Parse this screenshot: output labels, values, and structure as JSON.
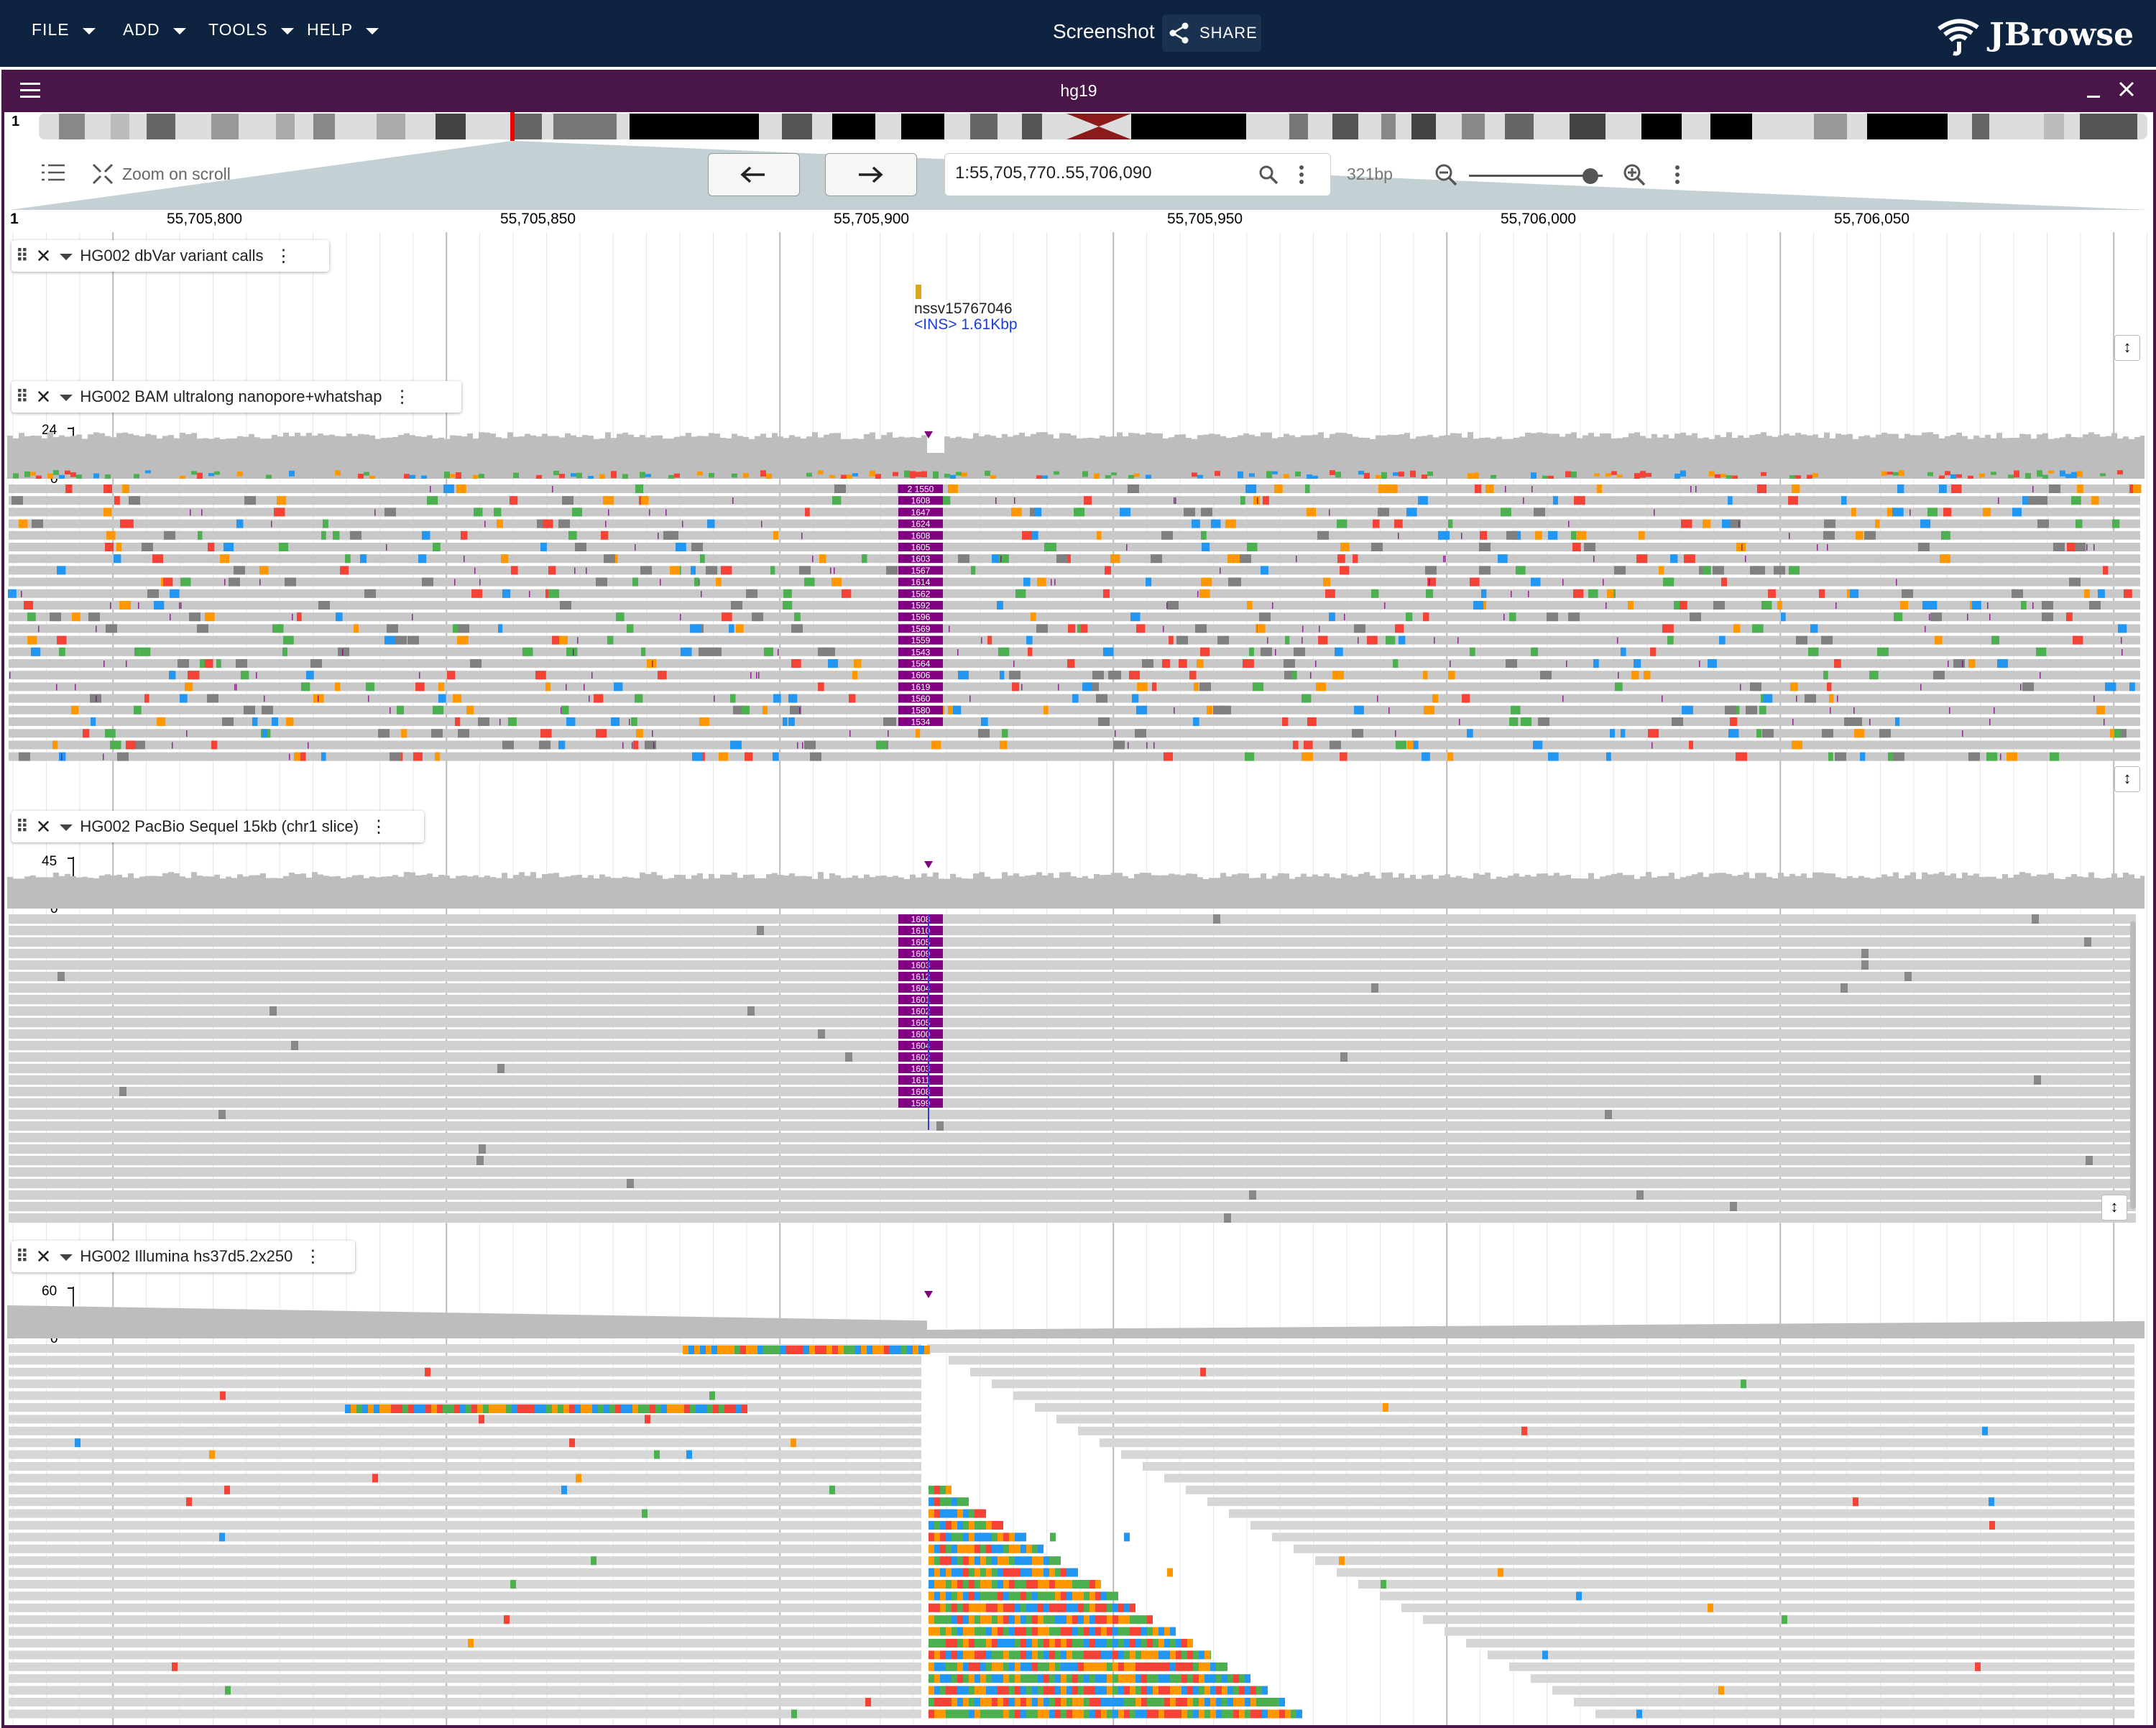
{
  "appbar": {
    "menus": [
      "FILE",
      "ADD",
      "TOOLS",
      "HELP"
    ],
    "session_name": "Screenshot",
    "share_label": "SHARE",
    "logo_text": "JBrowse"
  },
  "view": {
    "assembly": "hg19",
    "chromosome": "1",
    "zoom_on_scroll_label": "Zoom on scroll",
    "locstring": "1:55,705,770..55,706,090",
    "bp_label": "321bp",
    "ruler_chr": "1",
    "ruler_ticks": [
      "55,705,800",
      "55,705,850",
      "55,705,900",
      "55,705,950",
      "55,706,000",
      "55,706,050"
    ]
  },
  "tracks": [
    {
      "name": "HG002 dbVar variant calls",
      "feature_name": "nssv15767046",
      "feature_desc": "<INS> 1.61Kbp"
    },
    {
      "name": "HG002 BAM ultralong nanopore+whatshap",
      "coverage_max": "24",
      "coverage_min": "0",
      "insertion_labels": [
        "2 1550",
        "1608",
        "1647",
        "1624",
        "1608",
        "1605",
        "1603",
        "1567",
        "1614",
        "1562",
        "1592",
        "1596",
        "1569",
        "1559",
        "1543",
        "1564",
        "1606",
        "1619",
        "1560",
        "1580",
        "1534"
      ]
    },
    {
      "name": "HG002 PacBio Sequel 15kb (chr1 slice)",
      "coverage_max": "45",
      "coverage_min": "0",
      "insertion_labels": [
        "1608",
        "1610",
        "1605",
        "1609",
        "1603",
        "1612",
        "1604",
        "1601",
        "1602",
        "1605",
        "1600",
        "1604",
        "1602",
        "1603",
        "1611",
        "1608",
        "1599"
      ]
    },
    {
      "name": "HG002 Illumina hs37d5.2x250",
      "coverage_max": "60",
      "coverage_min": "0"
    }
  ],
  "colors": {
    "appbar": "#0d233f",
    "view_header": "#4a1548",
    "read_fill": "#c8c8c8",
    "insertion": "#800080",
    "base_A": "#4caf50",
    "base_C": "#2196f3",
    "base_G": "#ff9800",
    "base_T": "#f44336"
  }
}
